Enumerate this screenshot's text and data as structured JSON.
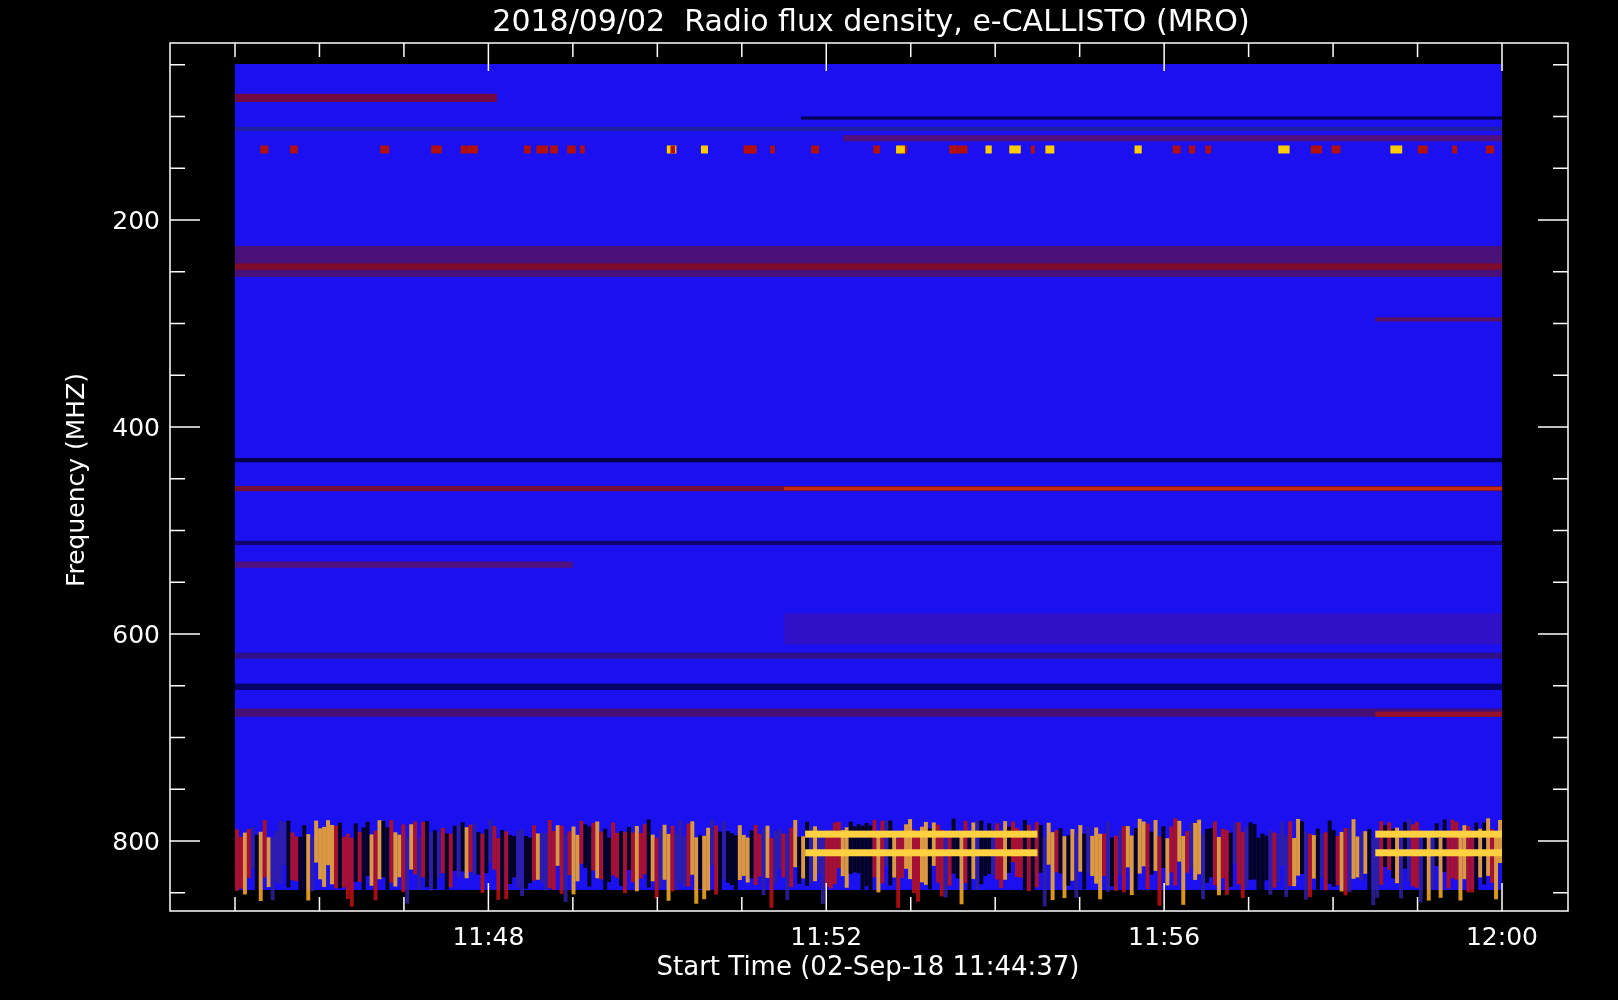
{
  "title": "2018/09/02  Radio flux density, e-CALLISTO (MRO)",
  "y_axis": {
    "label": "Frequency (MHZ)",
    "ticks": [
      "200",
      "400",
      "600",
      "800"
    ]
  },
  "x_axis": {
    "label": "Start Time (02-Sep-18 11:44:37)",
    "ticks": [
      "11:48",
      "11:52",
      "11:56",
      "12:00"
    ]
  }
}
